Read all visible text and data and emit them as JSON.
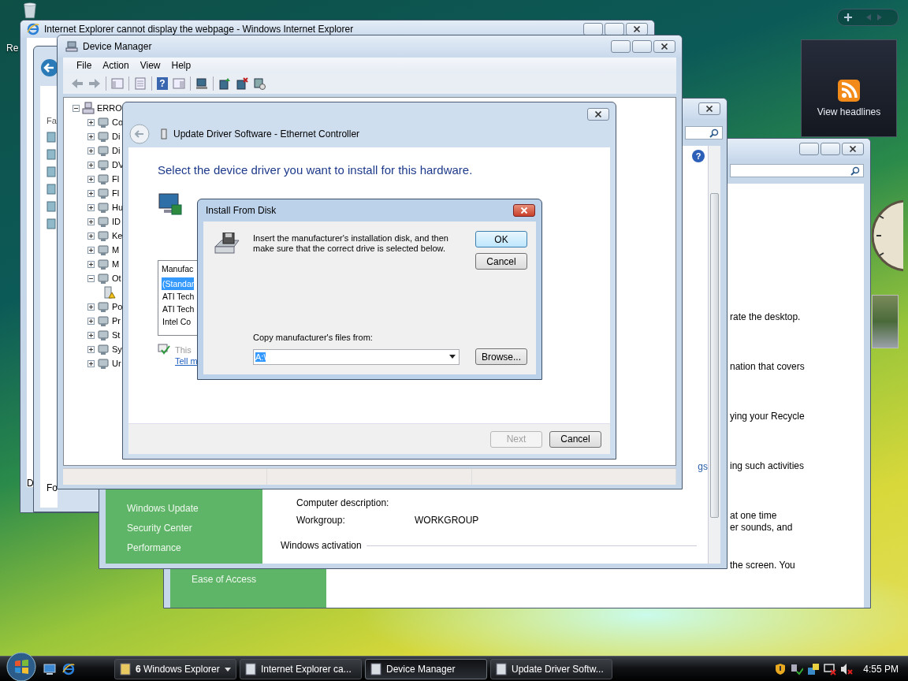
{
  "desktop": {
    "recycle_bin_label": "Re"
  },
  "gadgets": {
    "feed_caption": "View headlines"
  },
  "personalization_window": {
    "nav_items": [
      "Ease of Access"
    ],
    "paragraphs": [
      [
        "rate the desktop."
      ],
      [
        "nation that covers"
      ],
      [
        "ying your Recycle"
      ],
      [
        "ing such activities"
      ],
      [
        "at one time",
        "er sounds, and"
      ],
      [
        "the screen. You"
      ]
    ]
  },
  "ie_window": {
    "title": "Internet Explorer cannot display the webpage - Windows Internet Explorer",
    "status_text": "D"
  },
  "explorer_window": {
    "pane_labels": [
      "Fa",
      "Fo"
    ]
  },
  "system_window": {
    "help_glyph": "?",
    "nav_items": [
      "Windows Update",
      "Security Center",
      "Performance"
    ],
    "link_fragment": "gs",
    "fields": [
      {
        "label": "Computer description:"
      },
      {
        "label": "Workgroup:",
        "value": "WORKGROUP"
      }
    ],
    "section_heading": "Windows activation"
  },
  "device_manager": {
    "title": "Device Manager",
    "toolbar_help_glyph": "?",
    "menu": [
      "File",
      "Action",
      "View",
      "Help"
    ],
    "tree": {
      "label": "ERRO",
      "expanded": true,
      "children": [
        {
          "label": "Co",
          "expanded": false
        },
        {
          "label": "Di",
          "expanded": false
        },
        {
          "label": "Di",
          "expanded": false
        },
        {
          "label": "DV",
          "expanded": false
        },
        {
          "label": "Fl",
          "expanded": false
        },
        {
          "label": "Fl",
          "expanded": false
        },
        {
          "label": "Hu",
          "expanded": false
        },
        {
          "label": "ID",
          "expanded": false
        },
        {
          "label": "Ke",
          "expanded": false
        },
        {
          "label": "M",
          "expanded": false
        },
        {
          "label": "M",
          "expanded": false
        },
        {
          "label": "Ot",
          "expanded": true,
          "children": [
            {
              "kind": "warning-device"
            }
          ]
        },
        {
          "label": "Po",
          "expanded": false
        },
        {
          "label": "Pr",
          "expanded": false
        },
        {
          "label": "St",
          "expanded": false
        },
        {
          "label": "Sy",
          "expanded": false
        },
        {
          "label": "Ur",
          "expanded": false
        }
      ]
    }
  },
  "wizard": {
    "title": "Update Driver Software - Ethernet Controller",
    "heading": "Select the device driver you want to install for this hardware.",
    "list_header": "Manufac",
    "manufacturers": [
      {
        "label": "(Standar",
        "selected": true
      },
      {
        "label": "ATI Tech",
        "selected": false
      },
      {
        "label": "ATI Tech",
        "selected": false
      },
      {
        "label": "Intel Co",
        "selected": false
      }
    ],
    "signed_note": "This",
    "help_link": "Tell m",
    "buttons": [
      {
        "label": "Next",
        "disabled": true
      },
      {
        "label": "Cancel",
        "disabled": false
      }
    ]
  },
  "install_dialog": {
    "title": "Install From Disk",
    "message_lines": [
      "Insert the manufacturer's installation disk, and then",
      "make sure that the correct drive is selected below."
    ],
    "ok": "OK",
    "cancel": "Cancel",
    "copy_label": "Copy manufacturer's files from:",
    "path": {
      "value": "A:\\",
      "selected": true
    },
    "browse": "Browse..."
  },
  "taskbar": {
    "buttons": [
      {
        "label": "**6** Windows Explorer",
        "kind": "group",
        "active": false
      },
      {
        "label": "Internet Explorer ca...",
        "kind": "single",
        "active": false
      },
      {
        "label": "Device Manager",
        "kind": "single",
        "active": true
      },
      {
        "label": "Update Driver Softw...",
        "kind": "single",
        "active": false
      }
    ],
    "clock": "4:55 PM"
  }
}
